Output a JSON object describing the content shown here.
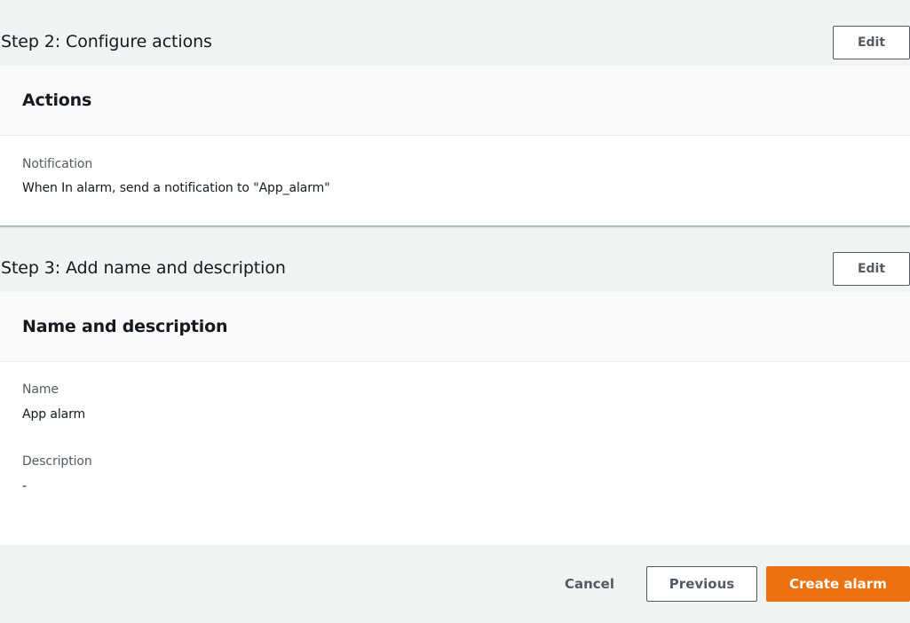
{
  "step2": {
    "title": "Step 2: Configure actions",
    "edit_label": "Edit",
    "card_title": "Actions",
    "notification_label": "Notification",
    "notification_value": "When In alarm, send a notification to \"App_alarm\""
  },
  "step3": {
    "title": "Step 3: Add name and description",
    "edit_label": "Edit",
    "card_title": "Name and description",
    "name_label": "Name",
    "name_value": "App alarm",
    "description_label": "Description",
    "description_value": "-"
  },
  "footer": {
    "cancel_label": "Cancel",
    "previous_label": "Previous",
    "create_label": "Create alarm"
  },
  "colors": {
    "primary_button": "#ec7211",
    "background": "#f2f3f3",
    "text": "#16191f",
    "secondary_text": "#545b64"
  }
}
